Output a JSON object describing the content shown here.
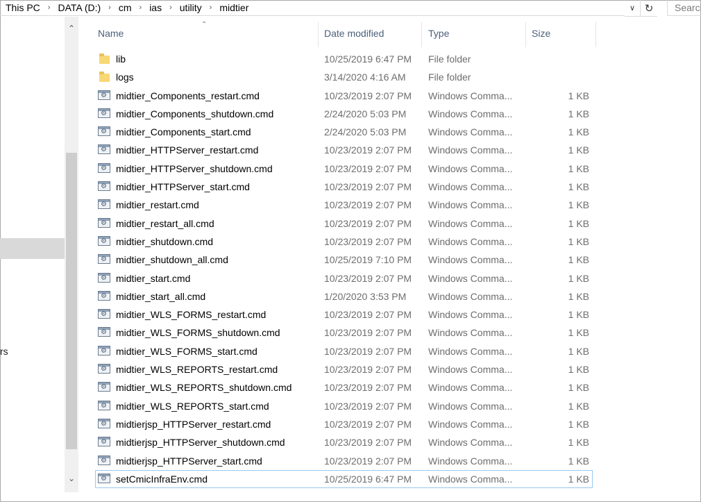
{
  "address": {
    "crumbs": [
      "This PC",
      "DATA (D:)",
      "cm",
      "ias",
      "utility",
      "midtier"
    ],
    "separator": "›",
    "dropdown_icon": "chevron-down-icon",
    "refresh_icon": "refresh-icon",
    "search_placeholder": "Search"
  },
  "nav": {
    "fragment": "rs"
  },
  "columns": {
    "name": "Name",
    "date": "Date modified",
    "type": "Type",
    "size": "Size"
  },
  "files": [
    {
      "name": "lib",
      "date": "10/25/2019 6:47 PM",
      "type": "File folder",
      "size": "",
      "icon": "folder-icon"
    },
    {
      "name": "logs",
      "date": "3/14/2020 4:16 AM",
      "type": "File folder",
      "size": "",
      "icon": "folder-icon"
    },
    {
      "name": "midtier_Components_restart.cmd",
      "date": "10/23/2019 2:07 PM",
      "type": "Windows Comma...",
      "size": "1 KB",
      "icon": "cmd-file-icon"
    },
    {
      "name": "midtier_Components_shutdown.cmd",
      "date": "2/24/2020 5:03 PM",
      "type": "Windows Comma...",
      "size": "1 KB",
      "icon": "cmd-file-icon"
    },
    {
      "name": "midtier_Components_start.cmd",
      "date": "2/24/2020 5:03 PM",
      "type": "Windows Comma...",
      "size": "1 KB",
      "icon": "cmd-file-icon"
    },
    {
      "name": "midtier_HTTPServer_restart.cmd",
      "date": "10/23/2019 2:07 PM",
      "type": "Windows Comma...",
      "size": "1 KB",
      "icon": "cmd-file-icon"
    },
    {
      "name": "midtier_HTTPServer_shutdown.cmd",
      "date": "10/23/2019 2:07 PM",
      "type": "Windows Comma...",
      "size": "1 KB",
      "icon": "cmd-file-icon"
    },
    {
      "name": "midtier_HTTPServer_start.cmd",
      "date": "10/23/2019 2:07 PM",
      "type": "Windows Comma...",
      "size": "1 KB",
      "icon": "cmd-file-icon"
    },
    {
      "name": "midtier_restart.cmd",
      "date": "10/23/2019 2:07 PM",
      "type": "Windows Comma...",
      "size": "1 KB",
      "icon": "cmd-file-icon"
    },
    {
      "name": "midtier_restart_all.cmd",
      "date": "10/23/2019 2:07 PM",
      "type": "Windows Comma...",
      "size": "1 KB",
      "icon": "cmd-file-icon"
    },
    {
      "name": "midtier_shutdown.cmd",
      "date": "10/23/2019 2:07 PM",
      "type": "Windows Comma...",
      "size": "1 KB",
      "icon": "cmd-file-icon"
    },
    {
      "name": "midtier_shutdown_all.cmd",
      "date": "10/25/2019 7:10 PM",
      "type": "Windows Comma...",
      "size": "1 KB",
      "icon": "cmd-file-icon"
    },
    {
      "name": "midtier_start.cmd",
      "date": "10/23/2019 2:07 PM",
      "type": "Windows Comma...",
      "size": "1 KB",
      "icon": "cmd-file-icon"
    },
    {
      "name": "midtier_start_all.cmd",
      "date": "1/20/2020 3:53 PM",
      "type": "Windows Comma...",
      "size": "1 KB",
      "icon": "cmd-file-icon"
    },
    {
      "name": "midtier_WLS_FORMS_restart.cmd",
      "date": "10/23/2019 2:07 PM",
      "type": "Windows Comma...",
      "size": "1 KB",
      "icon": "cmd-file-icon"
    },
    {
      "name": "midtier_WLS_FORMS_shutdown.cmd",
      "date": "10/23/2019 2:07 PM",
      "type": "Windows Comma...",
      "size": "1 KB",
      "icon": "cmd-file-icon"
    },
    {
      "name": "midtier_WLS_FORMS_start.cmd",
      "date": "10/23/2019 2:07 PM",
      "type": "Windows Comma...",
      "size": "1 KB",
      "icon": "cmd-file-icon"
    },
    {
      "name": "midtier_WLS_REPORTS_restart.cmd",
      "date": "10/23/2019 2:07 PM",
      "type": "Windows Comma...",
      "size": "1 KB",
      "icon": "cmd-file-icon"
    },
    {
      "name": "midtier_WLS_REPORTS_shutdown.cmd",
      "date": "10/23/2019 2:07 PM",
      "type": "Windows Comma...",
      "size": "1 KB",
      "icon": "cmd-file-icon"
    },
    {
      "name": "midtier_WLS_REPORTS_start.cmd",
      "date": "10/23/2019 2:07 PM",
      "type": "Windows Comma...",
      "size": "1 KB",
      "icon": "cmd-file-icon"
    },
    {
      "name": "midtierjsp_HTTPServer_restart.cmd",
      "date": "10/23/2019 2:07 PM",
      "type": "Windows Comma...",
      "size": "1 KB",
      "icon": "cmd-file-icon"
    },
    {
      "name": "midtierjsp_HTTPServer_shutdown.cmd",
      "date": "10/23/2019 2:07 PM",
      "type": "Windows Comma...",
      "size": "1 KB",
      "icon": "cmd-file-icon"
    },
    {
      "name": "midtierjsp_HTTPServer_start.cmd",
      "date": "10/23/2019 2:07 PM",
      "type": "Windows Comma...",
      "size": "1 KB",
      "icon": "cmd-file-icon"
    },
    {
      "name": "setCmicInfraEnv.cmd",
      "date": "10/25/2019 6:47 PM",
      "type": "Windows Comma...",
      "size": "1 KB",
      "icon": "cmd-file-icon",
      "focused": true
    }
  ]
}
